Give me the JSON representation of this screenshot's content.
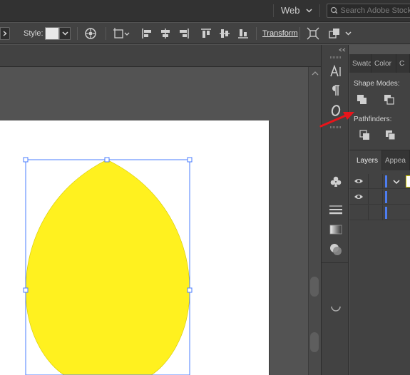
{
  "menubar": {
    "workspace_label": "Web",
    "search_placeholder": "Search Adobe Stock"
  },
  "controlbar": {
    "style_label": "Style:",
    "transform_label": "Transform"
  },
  "panels": {
    "top_tabs": [
      "Swatc",
      "Color",
      "C"
    ],
    "shape_modes_label": "Shape Modes:",
    "pathfinders_label": "Pathfinders:",
    "layers_tabs": [
      "Layers",
      "Appea"
    ]
  },
  "colors": {
    "shape_fill": "#fff11f",
    "selection": "#4a7cff",
    "annotation_arrow": "#e8141a"
  }
}
